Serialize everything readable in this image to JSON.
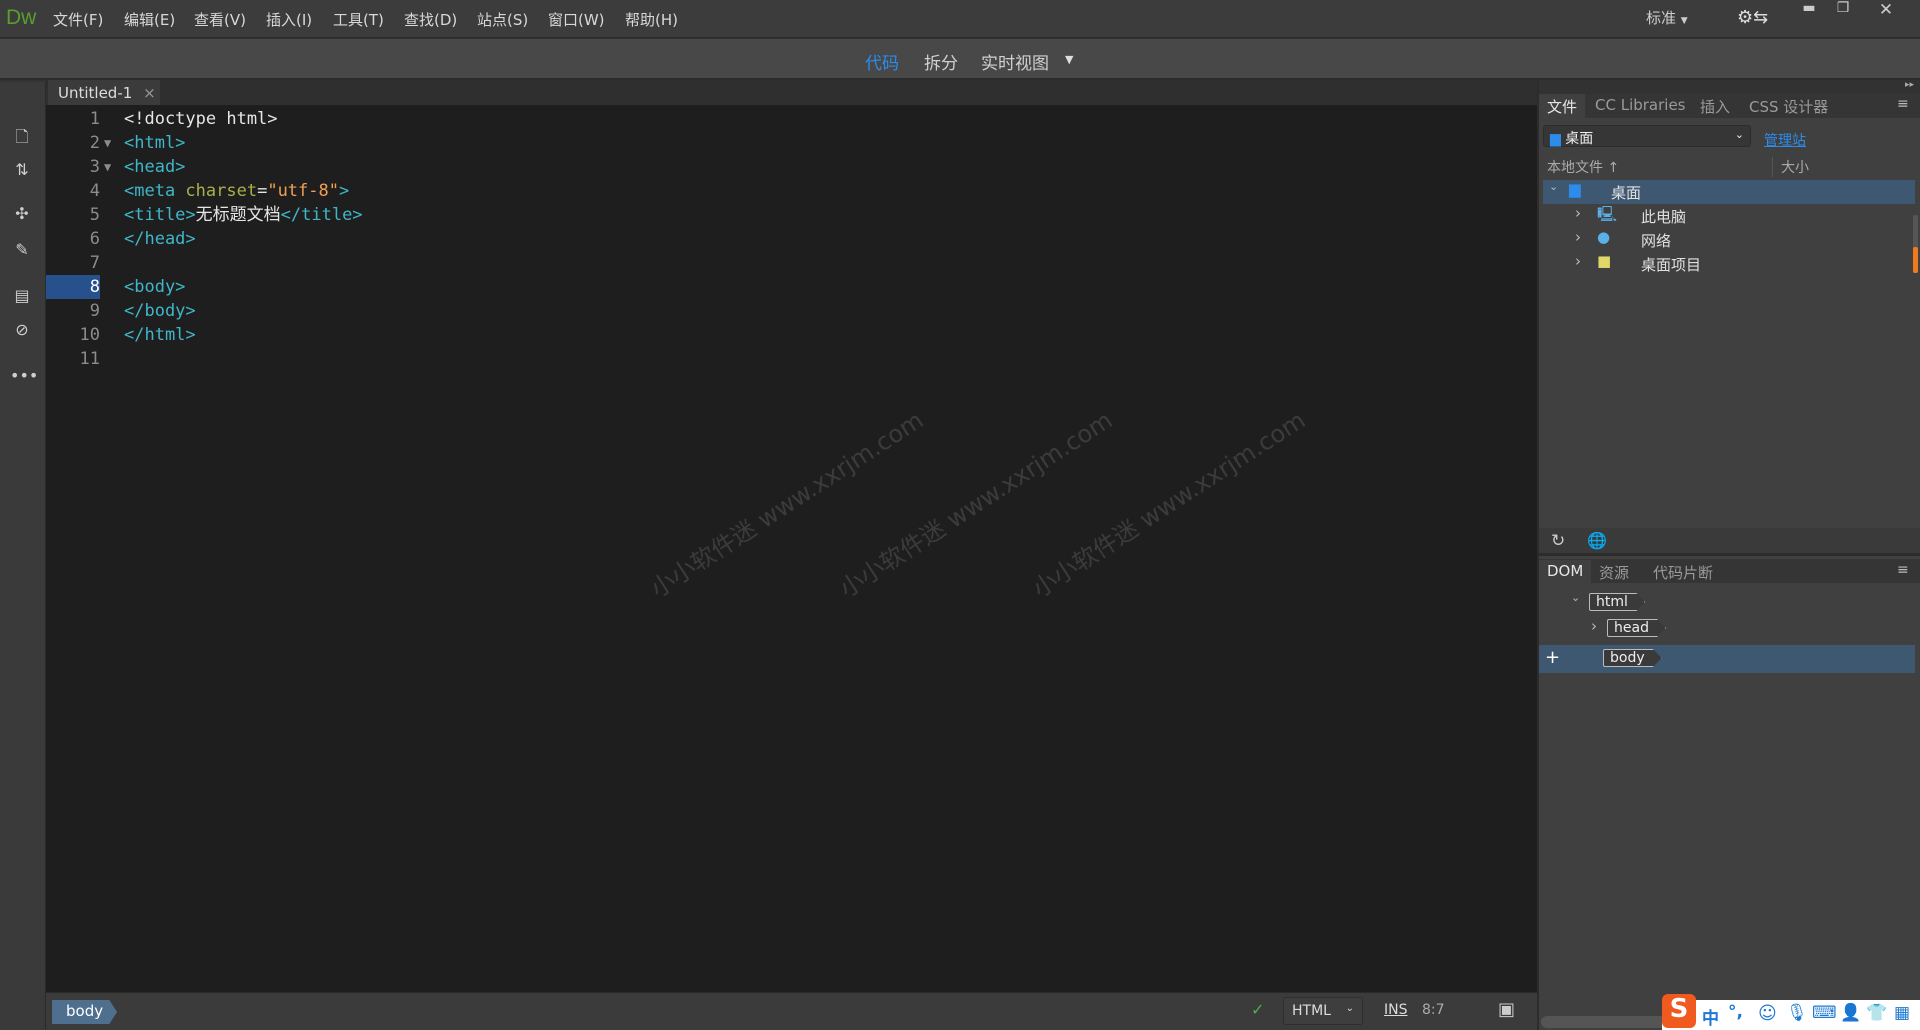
{
  "app": {
    "logo": "Dw"
  },
  "menu": [
    "文件(F)",
    "编辑(E)",
    "查看(V)",
    "插入(I)",
    "工具(T)",
    "查找(D)",
    "站点(S)",
    "窗口(W)",
    "帮助(H)"
  ],
  "workspace": {
    "label": "标准"
  },
  "views": {
    "code": "代码",
    "split": "拆分",
    "live": "实时视图",
    "active": "代码",
    "active_color": "#2d8ceb"
  },
  "document_tab": {
    "title": "Untitled-1",
    "close": "×"
  },
  "code_lines": [
    {
      "n": "1",
      "parts": [
        [
          "txt",
          "<!doctype html>"
        ]
      ]
    },
    {
      "n": "2",
      "fold": "▼",
      "parts": [
        [
          "tag",
          "<html>"
        ]
      ]
    },
    {
      "n": "3",
      "fold": "▼",
      "parts": [
        [
          "tag",
          "<head>"
        ]
      ]
    },
    {
      "n": "4",
      "parts": [
        [
          "tag",
          "<meta "
        ],
        [
          "attr",
          "charset"
        ],
        [
          "txt",
          "="
        ],
        [
          "val",
          "\"utf-8\""
        ],
        [
          "tag",
          ">"
        ]
      ]
    },
    {
      "n": "5",
      "parts": [
        [
          "tag",
          "<title>"
        ],
        [
          "txt",
          "无标题文档"
        ],
        [
          "tag",
          "</title>"
        ]
      ]
    },
    {
      "n": "6",
      "parts": [
        [
          "tag",
          "</head>"
        ]
      ]
    },
    {
      "n": "7",
      "parts": []
    },
    {
      "n": "8",
      "current": true,
      "parts": [
        [
          "tag",
          "<body>"
        ]
      ]
    },
    {
      "n": "9",
      "parts": [
        [
          "tag",
          "</body>"
        ]
      ]
    },
    {
      "n": "10",
      "parts": [
        [
          "tag",
          "</html>"
        ]
      ]
    },
    {
      "n": "11",
      "parts": []
    }
  ],
  "watermark": "小小软件迷 www.xxrjm.com",
  "status": {
    "breadcrumb": "body",
    "language": "HTML",
    "mode": "INS",
    "position": "8:7"
  },
  "files_panel": {
    "tabs": [
      "文件",
      "CC Libraries",
      "插入",
      "CSS 设计器"
    ],
    "site_select": "桌面",
    "manage_link": "管理站",
    "col_local": "本地文件",
    "col_size": "大小",
    "tree": [
      {
        "label": "桌面",
        "icon": "desktop-icon",
        "expanded": true
      },
      {
        "label": "此电脑",
        "icon": "computer-icon"
      },
      {
        "label": "网络",
        "icon": "network-icon"
      },
      {
        "label": "桌面项目",
        "icon": "folder-icon"
      }
    ]
  },
  "dom_panel": {
    "tabs": [
      "DOM",
      "资源",
      "代码片断"
    ],
    "nodes": [
      "html",
      "head",
      "body"
    ],
    "add": "+"
  },
  "ime": {
    "lang": "中",
    "punct": "°,"
  }
}
